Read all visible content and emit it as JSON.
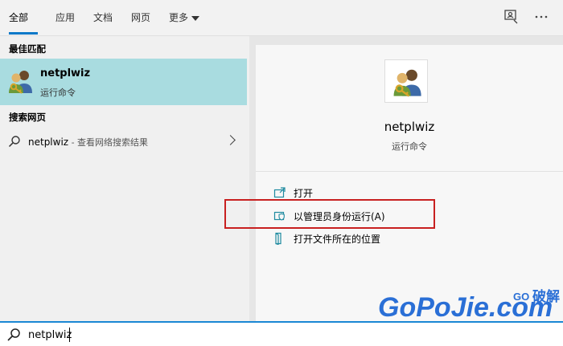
{
  "tabs": [
    {
      "label": "全部",
      "active": true
    },
    {
      "label": "应用"
    },
    {
      "label": "文档"
    },
    {
      "label": "网页"
    },
    {
      "label": "更多"
    }
  ],
  "best_match": {
    "heading": "最佳匹配",
    "title": "netplwiz",
    "subtitle": "运行命令"
  },
  "web_search": {
    "heading": "搜索网页",
    "query": "netplwiz",
    "suffix": " - 查看网络搜索结果"
  },
  "details": {
    "name": "netplwiz",
    "type": "运行命令",
    "actions": [
      {
        "label": "打开",
        "icon": "open-icon"
      },
      {
        "label": "以管理员身份运行(A)",
        "icon": "shield-icon"
      },
      {
        "label": "打开文件所在的位置",
        "icon": "folder-location-icon"
      }
    ]
  },
  "watermark": {
    "brand": "GoPoJie.com",
    "tag": "破解"
  },
  "search": {
    "value": "netplwiz"
  },
  "colors": {
    "accent": "#0a78c8",
    "selection": "#a9dce0",
    "highlight": "#c82020"
  }
}
